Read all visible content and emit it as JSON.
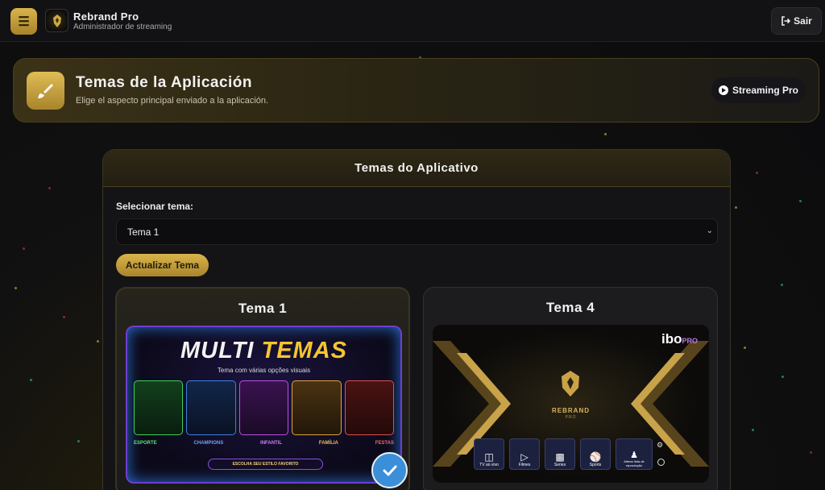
{
  "topbar": {
    "menu_icon": "hamburger-icon",
    "app_title": "Rebrand Pro",
    "app_subtitle": "Administrador de streaming",
    "logout_label": "Sair"
  },
  "header": {
    "title": "Temas de la Aplicación",
    "subtitle": "Elige el aspecto principal enviado a la aplicación.",
    "badge_label": "Streaming Pro"
  },
  "panel": {
    "title": "Temas do Aplicativo",
    "select_label": "Selecionar tema:",
    "select_value": "Tema 1",
    "update_button": "Actualizar Tema"
  },
  "themes": [
    {
      "name": "Tema 1",
      "selected": true,
      "preview": {
        "headline_a": "MULTI",
        "headline_b": "TEMAS",
        "tagline": "Tema com várias opções visuais",
        "categories": [
          "ESPORTE",
          "CHAMPIONS",
          "INFANTIL",
          "FAMÍLIA",
          "FESTAS"
        ],
        "footer": "ESCOLHA SEU ESTILO FAVORITO"
      }
    },
    {
      "name": "Tema 4",
      "selected": false,
      "preview": {
        "brand": "REBRAND",
        "brand_sub": "PRO",
        "logo_mark": "ibo",
        "logo_sub": "PRO",
        "menu": [
          "TV ao vivo",
          "Filmes",
          "Series",
          "Sports",
          "Alterar lista de reprodução"
        ]
      }
    }
  ],
  "colors": {
    "accent_gold": "#d9b44a",
    "check_blue": "#3a8fd8"
  }
}
